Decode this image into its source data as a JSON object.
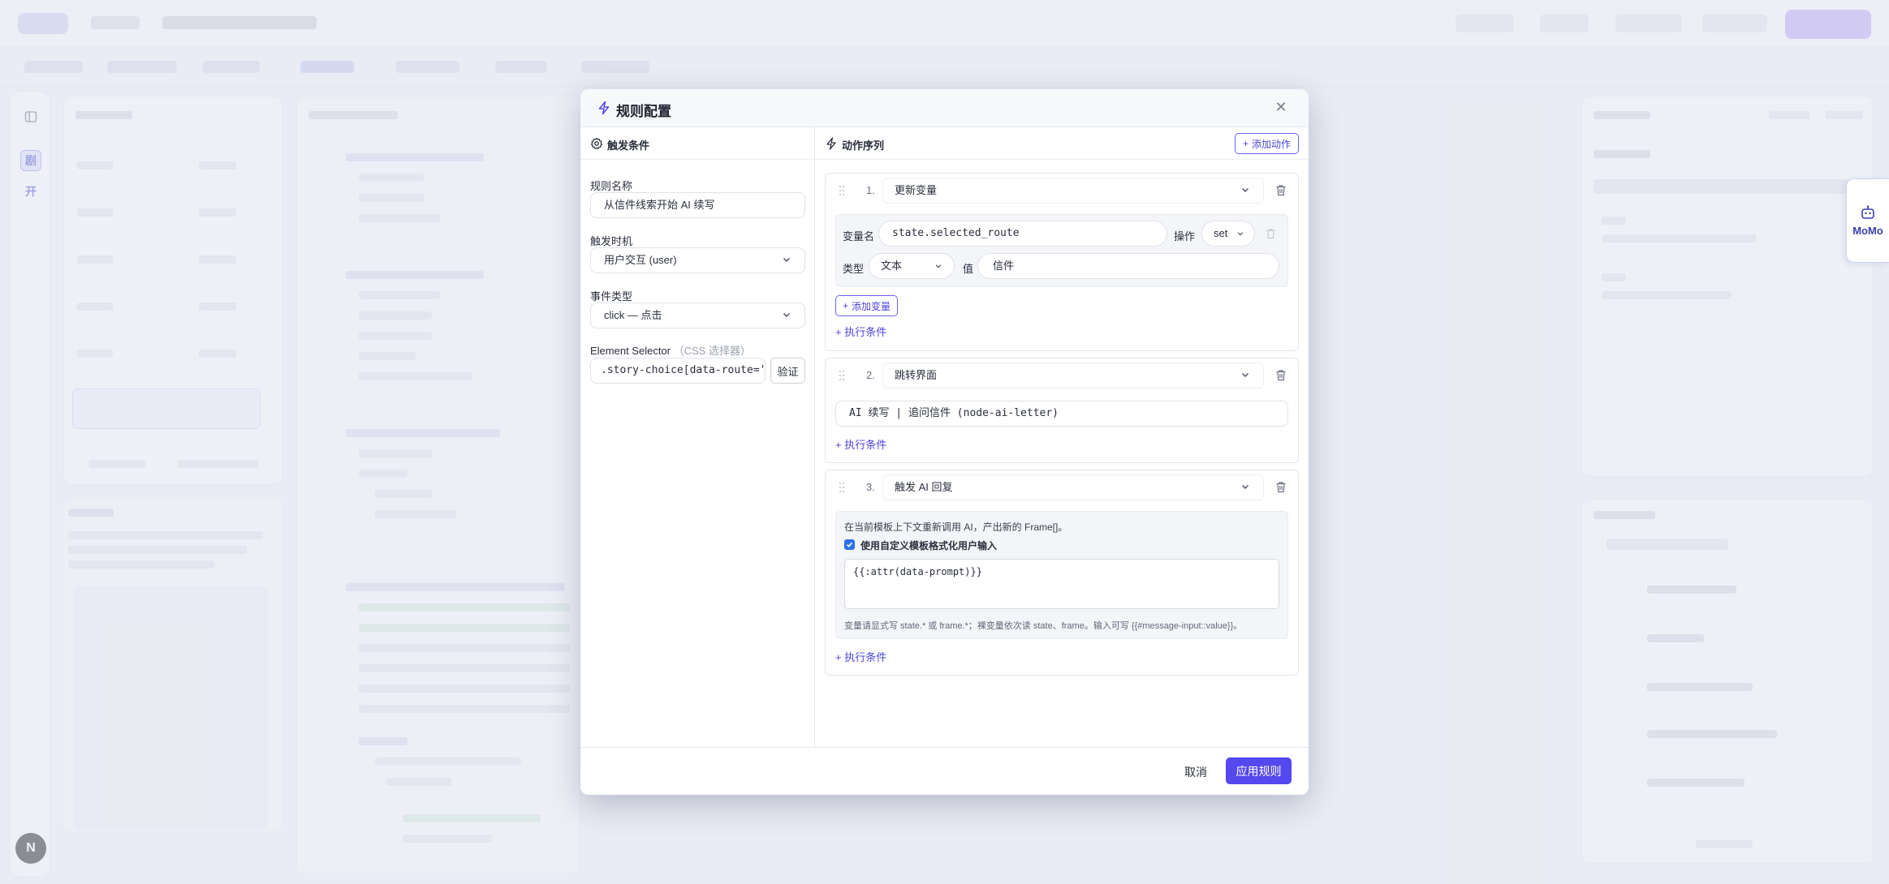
{
  "modal": {
    "title": "规则配置",
    "trigger": {
      "section_title": "触发条件",
      "rule_name_label": "规则名称",
      "rule_name_value": "从信件线索开始 AI 续写",
      "timing_label": "触发时机",
      "timing_value": "用户交互 (user)",
      "event_type_label": "事件类型",
      "event_type_value": "click — 点击",
      "selector_label": "Element Selector",
      "selector_sub": "（CSS 选择器）",
      "selector_value": ".story-choice[data-route='",
      "verify_label": "验证"
    },
    "actions": {
      "section_title": "动作序列",
      "add_action_label": "添加动作",
      "items": [
        {
          "index": "1.",
          "type": "更新变量",
          "var_name_label": "变量名",
          "var_name_value": "state.selected_route",
          "op_label": "操作",
          "op_value": "set",
          "type_label": "类型",
          "type_value": "文本",
          "value_label": "值",
          "value_value": "信件",
          "add_variable_label": "添加变量",
          "condition_link": "+ 执行条件"
        },
        {
          "index": "2.",
          "type": "跳转界面",
          "target_value": "AI 续写 | 追问信件 (node-ai-letter)",
          "condition_link": "+ 执行条件"
        },
        {
          "index": "3.",
          "type": "触发 AI 回复",
          "description": "在当前模板上下文重新调用 AI，产出新的 Frame[]。",
          "checkbox_label": "使用自定义模板格式化用户输入",
          "checkbox_checked": true,
          "template_value": "{{:attr(data-prompt)}}",
          "hint": "变量请显式写 state.* 或 frame.*；裸变量依次读 state、frame。输入可写 {{#message-input::value}}。",
          "condition_link": "+ 执行条件"
        }
      ]
    },
    "footer": {
      "cancel_label": "取消",
      "apply_label": "应用规则"
    }
  },
  "side_tab": {
    "label": "MoMo"
  },
  "rail": {
    "item1": "剧",
    "item2": "开",
    "avatar": "N"
  },
  "colors": {
    "primary": "#5548ee",
    "link": "#4d45d9"
  }
}
